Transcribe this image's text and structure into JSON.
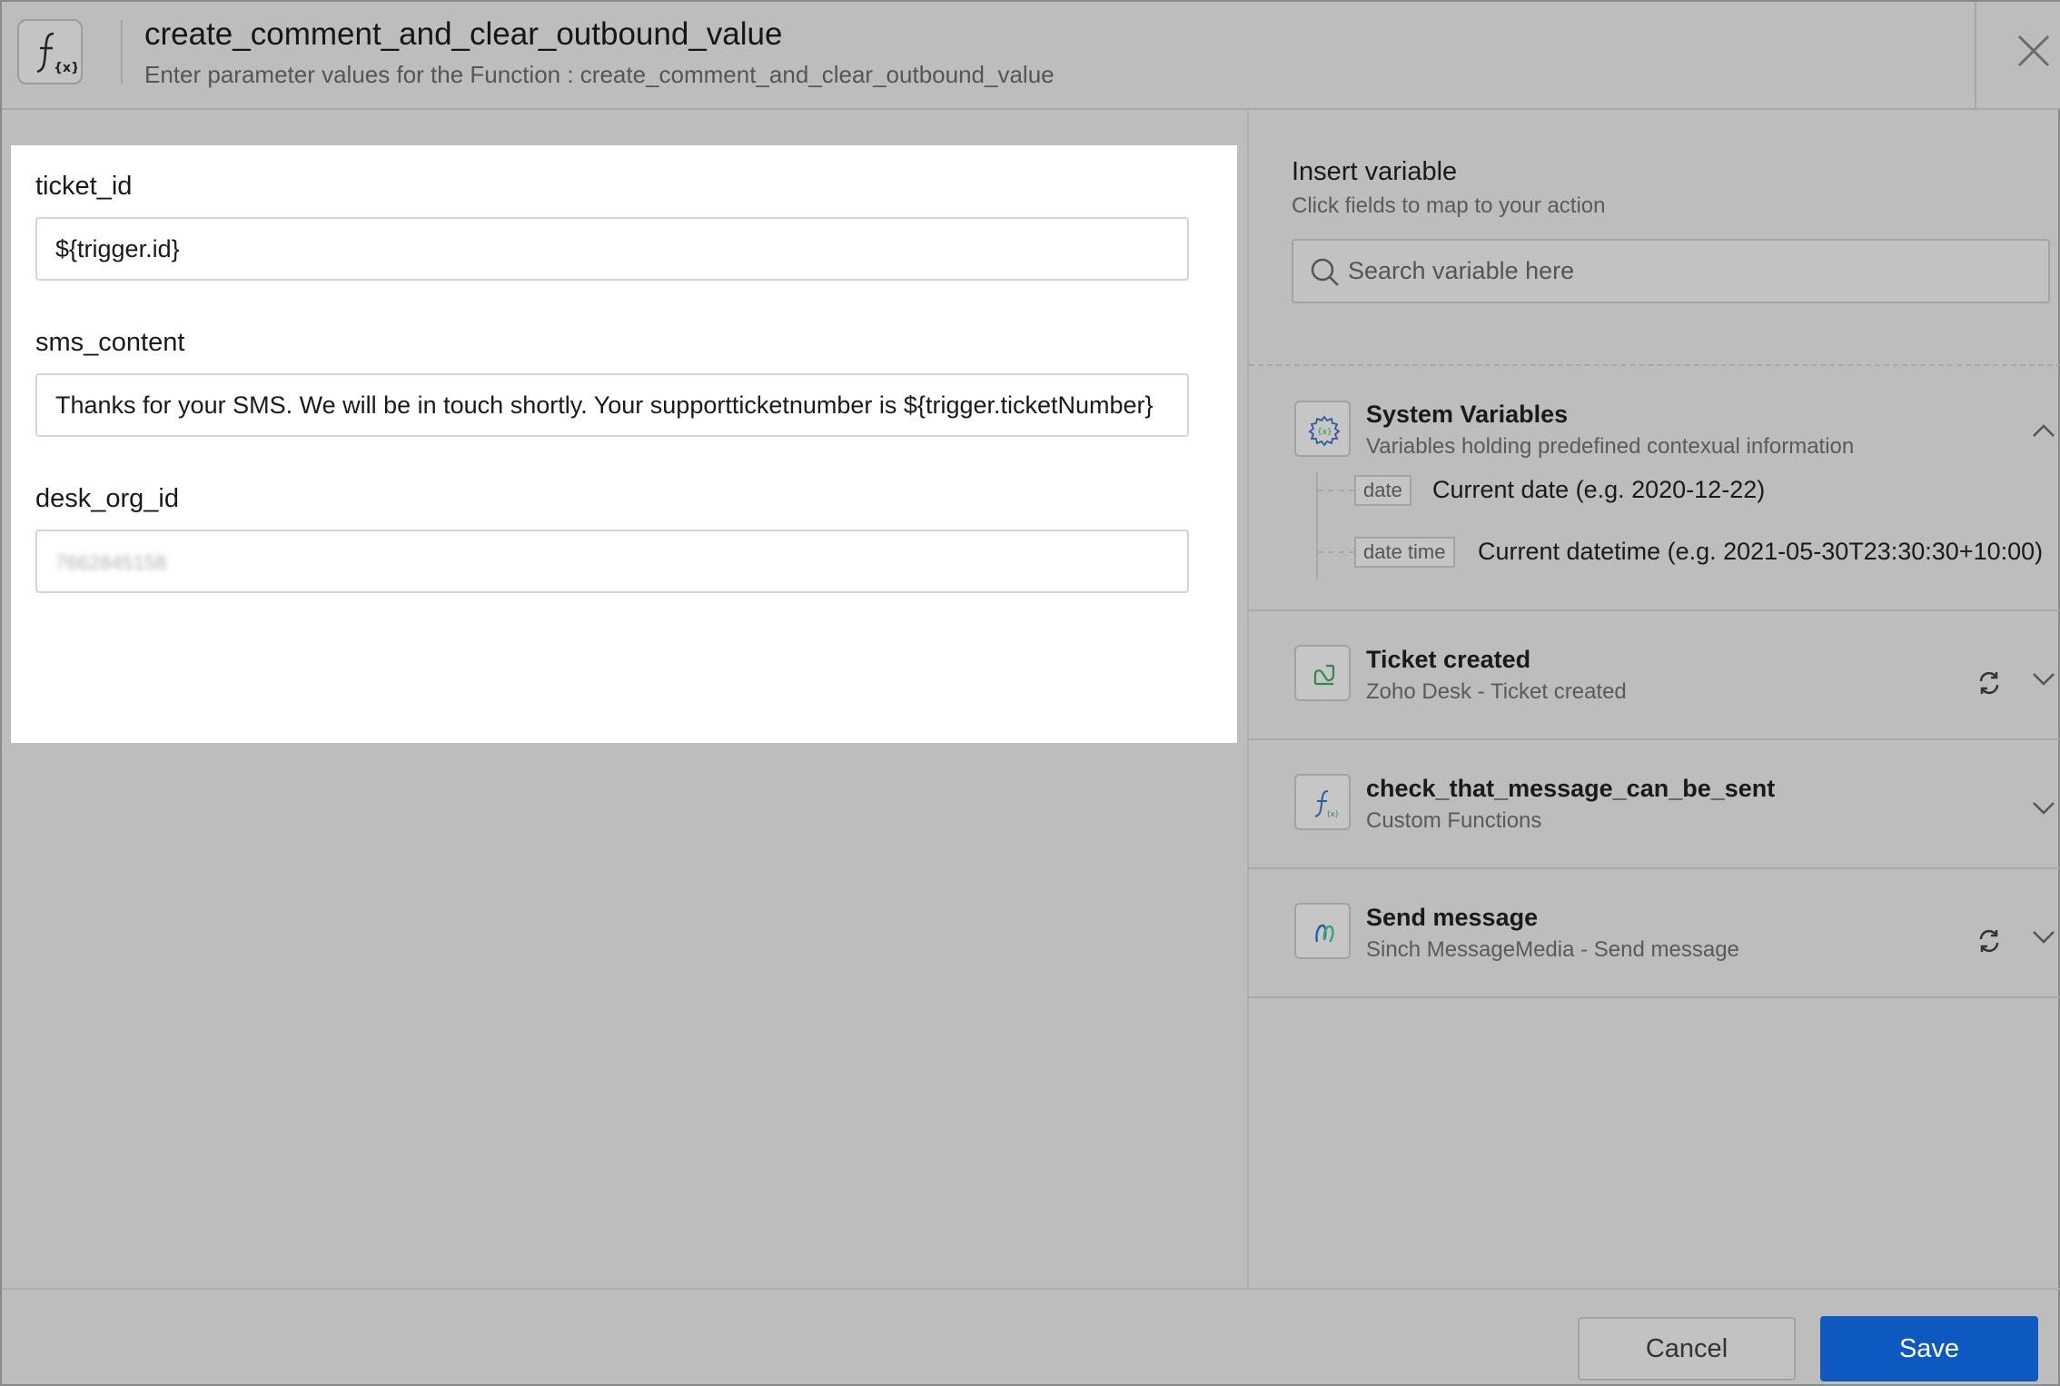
{
  "header": {
    "title": "create_comment_and_clear_outbound_value",
    "subtitle": "Enter parameter values for the Function : create_comment_and_clear_outbound_value",
    "icon": "function-icon"
  },
  "form": {
    "fields": [
      {
        "label": "ticket_id",
        "value": "${trigger.id}"
      },
      {
        "label": "sms_content",
        "value": "Thanks for your SMS. We will be in touch shortly. Your supportticketnumber is ${trigger.ticketNumber}"
      },
      {
        "label": "desk_org_id",
        "value": "7662845158"
      }
    ]
  },
  "variables_panel": {
    "title": "Insert variable",
    "subtitle": "Click fields to map to your action",
    "search_placeholder": "Search variable here",
    "groups": [
      {
        "title": "System Variables",
        "subtitle": "Variables holding predefined contexual information",
        "icon": "gear-icon",
        "expanded": true,
        "items": [
          {
            "tag": "date",
            "description": "Current date (e.g. 2020-12-22)"
          },
          {
            "tag": "date time",
            "description": "Current datetime (e.g. 2021-05-30T23:30:30+10:00)"
          }
        ]
      },
      {
        "title": "Ticket created",
        "subtitle": "Zoho Desk - Ticket created",
        "icon": "zoho-desk-icon",
        "expanded": false,
        "refreshable": true
      },
      {
        "title": "check_that_message_can_be_sent",
        "subtitle": "Custom Functions",
        "icon": "function-icon",
        "expanded": false,
        "refreshable": false
      },
      {
        "title": "Send message",
        "subtitle": "Sinch MessageMedia - Send message",
        "icon": "messagemedia-icon",
        "expanded": false,
        "refreshable": true
      }
    ]
  },
  "footer": {
    "cancel_label": "Cancel",
    "save_label": "Save"
  },
  "colors": {
    "primary": "#0d59bf",
    "overlay": "#bdbdbd"
  }
}
